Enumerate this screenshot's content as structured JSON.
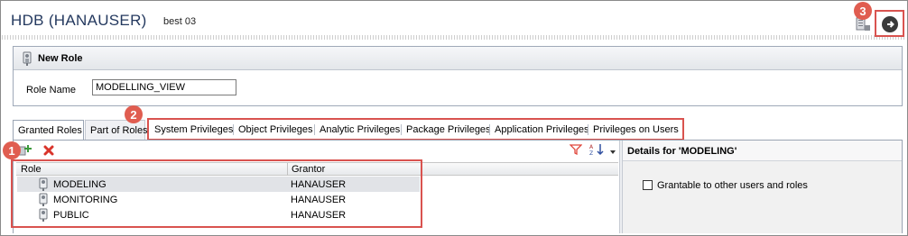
{
  "header": {
    "title": "HDB (HANAUSER)",
    "subtitle": "best 03"
  },
  "badges": [
    "1",
    "2",
    "3"
  ],
  "new_role": {
    "section_title": "New Role",
    "role_name_label": "Role Name",
    "role_name_value": "MODELLING_VIEW"
  },
  "tabs": [
    {
      "label": "Granted Roles",
      "active": true
    },
    {
      "label": "Part of Roles"
    },
    {
      "label": "System Privileges"
    },
    {
      "label": "Object Privileges"
    },
    {
      "label": "Analytic Privileges"
    },
    {
      "label": "Package Privileges"
    },
    {
      "label": "Application Privileges"
    },
    {
      "label": "Privileges on Users"
    }
  ],
  "roles_table": {
    "columns": [
      "Role",
      "Grantor"
    ],
    "rows": [
      {
        "role": "MODELING",
        "grantor": "HANAUSER",
        "selected": true
      },
      {
        "role": "MONITORING",
        "grantor": "HANAUSER"
      },
      {
        "role": "PUBLIC",
        "grantor": "HANAUSER"
      }
    ]
  },
  "details": {
    "title": "Details for 'MODELING'",
    "checkbox_label": "Grantable to other users and roles",
    "checkbox_checked": false
  },
  "icons": [
    "role-icon",
    "add-icon",
    "delete-icon",
    "filter-icon",
    "sort-icon",
    "view-menu-icon",
    "export-icon",
    "run-icon"
  ],
  "colors": {
    "title": "#24395f",
    "highlight": "#d9534f",
    "delete": "#d9342b",
    "filter": "#e0473c"
  }
}
